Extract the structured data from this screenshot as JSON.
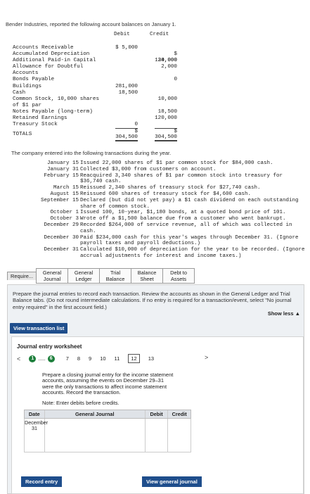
{
  "intro": "Bender Industries, reported the following account balances on January 1.",
  "balances": {
    "debit_header": "Debit",
    "credit_header": "Credit",
    "rows": [
      {
        "name": "Accounts Receivable",
        "debit": "$ 5,000",
        "credit": ""
      },
      {
        "name": "Accumulated Depreciation",
        "debit": "",
        "credit": "$\n30,000"
      },
      {
        "name": "Additional Paid-in Capital",
        "debit": "",
        "credit": "124,000"
      },
      {
        "name": "Allowance for Doubtful Accounts",
        "debit": "",
        "credit": "2,000"
      },
      {
        "name": "Bonds Payable",
        "debit": "",
        "credit": "0"
      },
      {
        "name": "Buildings",
        "debit": "281,000",
        "credit": ""
      },
      {
        "name": "Cash",
        "debit": "18,500",
        "credit": ""
      },
      {
        "name": "Common Stock, 10,000 shares of $1 par",
        "debit": "",
        "credit": "10,000"
      },
      {
        "name": "Notes Payable (long-term)",
        "debit": "",
        "credit": "18,500"
      },
      {
        "name": "Retained Earnings",
        "debit": "",
        "credit": "120,000"
      },
      {
        "name": "Treasury Stock",
        "debit": "0",
        "credit": ""
      }
    ],
    "totals_label": "TOTALS",
    "total_debit": "$\n304,500",
    "total_credit": "$\n304,500"
  },
  "transactions_intro": "The company entered into the following transactions during the year.",
  "transactions": [
    {
      "date": "January 15",
      "text": "Issued 22,000 shares of $1 par common stock for $84,000 cash."
    },
    {
      "date": "January 31",
      "text": "Collected $3,000 from customers on account."
    },
    {
      "date": "February 15",
      "text": "Reacquired 3,340 shares of $1 par common stock into treasury for $36,740 cash."
    },
    {
      "date": "March 15",
      "text": "Reissued 2,340 shares of treasury stock for $27,740 cash."
    },
    {
      "date": "August 15",
      "text": "Reissued 600 shares of treasury stock for $4,600 cash."
    },
    {
      "date": "September 15",
      "text": "Declared (but did not yet pay) a $1 cash dividend on each outstanding share of common stock."
    },
    {
      "date": "October 1",
      "text": "Issued 100, 10-year, $1,180 bonds, at a quoted bond price of 101."
    },
    {
      "date": "October 3",
      "text": "Wrote off a $1,500 balance due from a customer who went bankrupt."
    },
    {
      "date": "December 29",
      "text": "Recorded $264,000 of service revenue, all of which was collected in cash."
    },
    {
      "date": "December 30",
      "text": "Paid $234,000 cash for this year's wages through December 31. (Ignore payroll taxes and payroll deductions.)"
    },
    {
      "date": "December 31",
      "text": "Calculated $10,000 of depreciation for the year to be recorded. (Ignore accrual adjustments for interest and income taxes.)"
    }
  ],
  "tabs": [
    {
      "label": "Require..."
    },
    {
      "label": "General Journal"
    },
    {
      "label": "General Ledger"
    },
    {
      "label": "Trial Balance"
    },
    {
      "label": "Balance Sheet"
    },
    {
      "label": "Debt to Assets"
    }
  ],
  "instructions": "Prepare the journal entries to record each transaction. Review the accounts as shown in the General Ledger and Trial Balance tabs. (Do not round intermediate calculations. If no entry is required for a transaction/event, select \"No journal entry required\" in the first account field.)",
  "show_less": "Show less ▲",
  "view_transaction_list": "View transaction list",
  "worksheet": {
    "title": "Journal entry worksheet",
    "nav": {
      "left_arrow": "<",
      "current_marker": "1",
      "dots": ".....",
      "completed": "6",
      "steps": [
        "7",
        "8",
        "9",
        "10",
        "11",
        "12",
        "13"
      ],
      "active_step": "12",
      "right_arrow": ">"
    },
    "prompt": "Prepare a closing journal entry for the income statement accounts, assuming the events on December 29–31 were the only transactions to affect income statement accounts. Record the transaction.",
    "note": "Note: Enter debits before credits.",
    "table": {
      "headers": [
        "Date",
        "General Journal",
        "Debit",
        "Credit"
      ],
      "date_value": "December 31"
    }
  },
  "record_entry": "Record entry",
  "view_general_journal": "View general journal"
}
